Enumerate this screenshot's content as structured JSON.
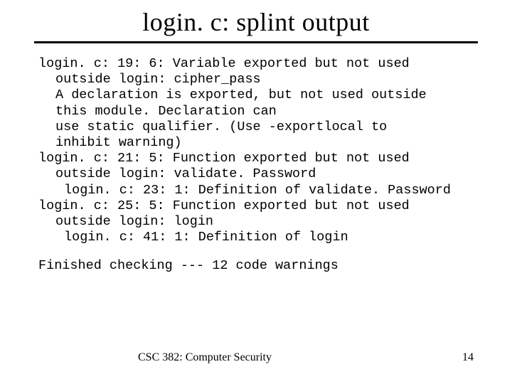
{
  "title": "login. c: splint output",
  "lines": {
    "l1": "login. c: 19: 6: Variable exported but not used",
    "l2": "outside login: cipher_pass",
    "l3": "A declaration is exported, but not used outside",
    "l4": "this module. Declaration can",
    "l5": "use static qualifier. (Use -exportlocal to",
    "l6": "inhibit warning)",
    "l7": "login. c: 21: 5: Function exported but not used",
    "l8": "outside login: validate. Password",
    "l9": "login. c: 23: 1: Definition of validate. Password",
    "l10": "login. c: 25: 5: Function exported but not used",
    "l11": "outside login: login",
    "l12": "login. c: 41: 1: Definition of login",
    "l13": "Finished checking --- 12 code warnings"
  },
  "footer": {
    "course": "CSC 382: Computer Security",
    "page": "14"
  }
}
